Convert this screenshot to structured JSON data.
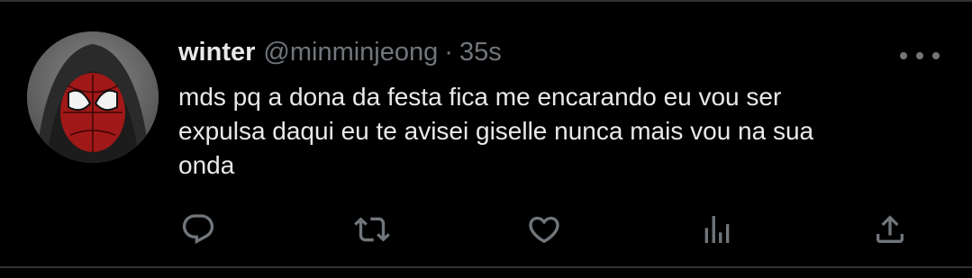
{
  "tweet": {
    "author_name": "winter",
    "handle": "@minminjeong",
    "separator": "·",
    "timestamp": "35s",
    "text": "mds pq a dona da festa fica me encarando eu vou ser\nexpulsa daqui eu te avisei giselle nunca mais vou na sua\nonda"
  },
  "icons": {
    "more": "more-horizontal-icon",
    "reply": "reply-icon",
    "retweet": "retweet-icon",
    "like": "heart-icon",
    "views": "analytics-icon",
    "share": "share-icon"
  },
  "colors": {
    "background": "#000000",
    "text_primary": "#e7e9ea",
    "text_secondary": "#71767b",
    "divider": "#2f3336"
  }
}
